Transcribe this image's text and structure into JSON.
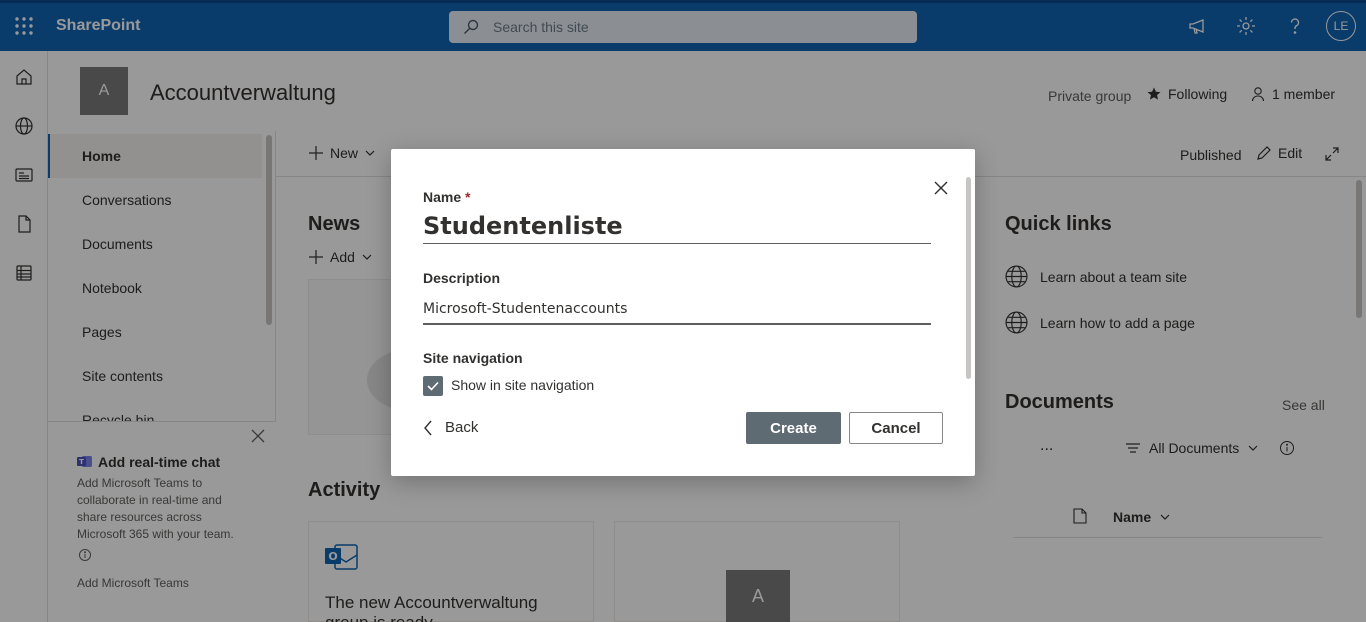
{
  "suite": {
    "app_name": "SharePoint",
    "search_placeholder": "Search this site",
    "user_initials": "LE"
  },
  "site": {
    "logo_letter": "A",
    "title": "Accountverwaltung",
    "privacy": "Private group",
    "following": "Following",
    "members": "1 member"
  },
  "nav": {
    "items": [
      {
        "label": "Home",
        "active": true
      },
      {
        "label": "Conversations"
      },
      {
        "label": "Documents"
      },
      {
        "label": "Notebook"
      },
      {
        "label": "Pages"
      },
      {
        "label": "Site contents"
      },
      {
        "label": "Recycle bin"
      }
    ]
  },
  "teams_panel": {
    "title": "Add real-time chat",
    "body": "Add Microsoft Teams to collaborate in real-time and share resources across Microsoft 365 with your team.",
    "link": "Add Microsoft Teams"
  },
  "command_bar": {
    "new_label": "New",
    "published": "Published",
    "edit": "Edit"
  },
  "news": {
    "title": "News",
    "add": "Add"
  },
  "activity": {
    "title": "Activity",
    "card1_text": "The new Accountverwaltung group is ready",
    "card2_letter": "A"
  },
  "quick_links": {
    "title": "Quick links",
    "items": [
      "Learn about a team site",
      "Learn how to add a page"
    ]
  },
  "documents": {
    "title": "Documents",
    "see_all": "See all",
    "more": "...",
    "view": "All Documents",
    "column_name": "Name"
  },
  "dialog": {
    "name_label": "Name",
    "required_mark": "*",
    "name_value": "Studentenliste",
    "description_label": "Description",
    "description_value": "Microsoft-Studentenaccounts",
    "site_nav_label": "Site navigation",
    "show_in_nav_label": "Show in site navigation",
    "show_in_nav_checked": true,
    "back_label": "Back",
    "create_label": "Create",
    "cancel_label": "Cancel"
  }
}
